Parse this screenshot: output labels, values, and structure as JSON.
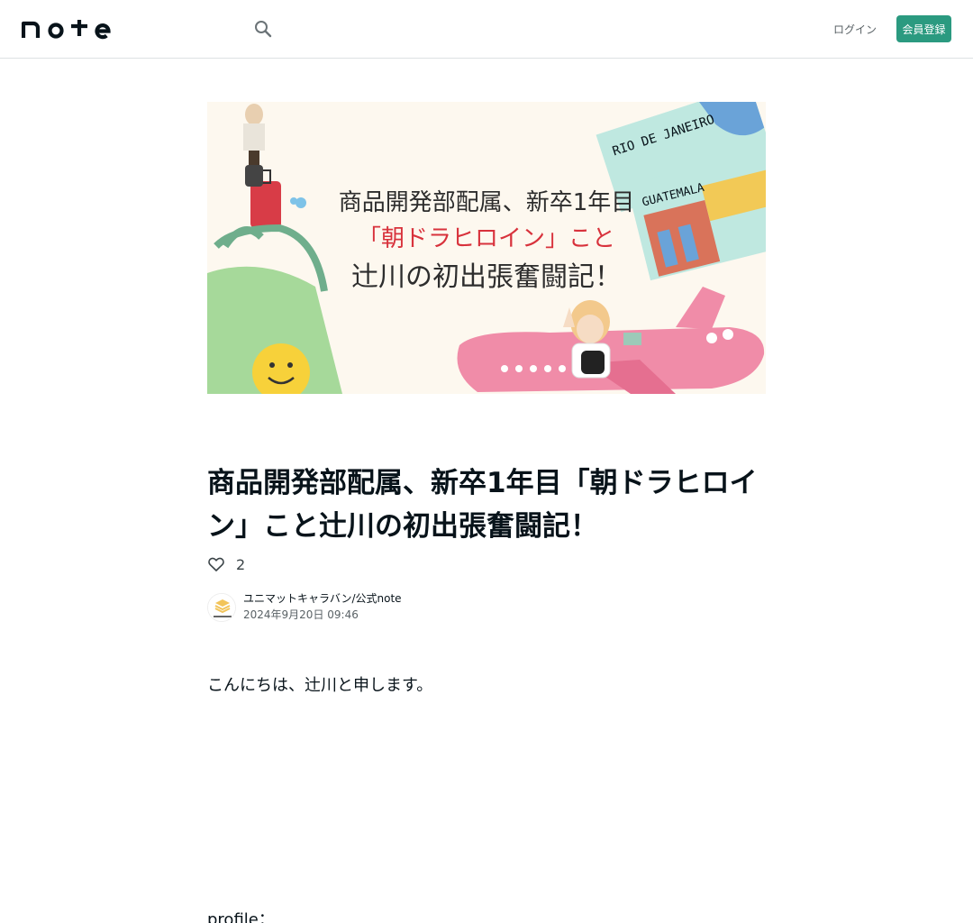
{
  "header": {
    "logo_text": "note",
    "search_icon": "search-icon",
    "login_label": "ログイン",
    "signup_label": "会員登録",
    "accent": "#2b9a80"
  },
  "eyecatch": {
    "line1": "商品開発部配属、新卒1年目",
    "line2": "「朝ドラヒロイン」こと",
    "line3": "辻川の初出張奮闘記！",
    "sign1": "RIO DE JANEIRO",
    "sign2": "GUATEMALA"
  },
  "article": {
    "title": "商品開発部配属、新卒1年目「朝ドラヒロイン」こと辻川の初出張奮闘記！",
    "like_count": "2",
    "author_name": "ユニマットキャラバン/公式note",
    "date": "2024年9月20日 09:46",
    "lead": "こんにちは、辻川と申します。",
    "profile_label": "profile："
  }
}
